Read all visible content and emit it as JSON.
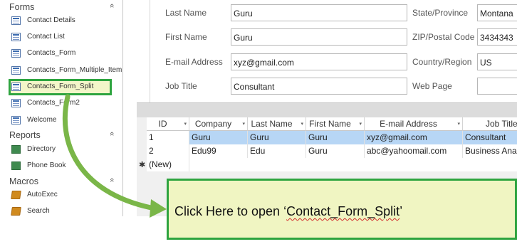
{
  "nav": {
    "groups": [
      {
        "title": "Forms",
        "chevron": "«",
        "icon": "chevron-up-icon"
      },
      {
        "title": "Reports",
        "chevron": "«",
        "icon": "chevron-up-icon"
      },
      {
        "title": "Macros",
        "chevron": "«",
        "icon": "chevron-up-icon"
      }
    ],
    "forms": [
      {
        "label": "Contact Details",
        "icon": "form-icon"
      },
      {
        "label": "Contact List",
        "icon": "form-icon"
      },
      {
        "label": "Contacts_Form",
        "icon": "form-icon"
      },
      {
        "label": "Contacts_Form_Multiple_Item",
        "icon": "form-icon"
      },
      {
        "label": "Contacts_Form_Split",
        "icon": "form-icon",
        "highlighted": true
      },
      {
        "label": "Contacts_Form2",
        "icon": "form-icon"
      },
      {
        "label": "Welcome",
        "icon": "form-icon"
      }
    ],
    "reports": [
      {
        "label": "Directory",
        "icon": "report-icon"
      },
      {
        "label": "Phone Book",
        "icon": "report-icon"
      }
    ],
    "macros": [
      {
        "label": "AutoExec",
        "icon": "macro-icon"
      },
      {
        "label": "Search",
        "icon": "macro-icon"
      }
    ]
  },
  "form": {
    "left": [
      {
        "label": "Last Name",
        "value": "Guru"
      },
      {
        "label": "First Name",
        "value": "Guru"
      },
      {
        "label": "E-mail Address",
        "value": "xyz@gmail.com"
      },
      {
        "label": "Job Title",
        "value": "Consultant"
      }
    ],
    "right": [
      {
        "label": "State/Province",
        "value": "Montana"
      },
      {
        "label": "ZIP/Postal Code",
        "value": "3434343"
      },
      {
        "label": "Country/Region",
        "value": "US"
      },
      {
        "label": "Web Page",
        "value": ""
      }
    ]
  },
  "grid": {
    "columns": [
      "ID",
      "Company",
      "Last Name",
      "First Name",
      "E-mail Address",
      "Job Title"
    ],
    "sort_arrow": "▾",
    "rows": [
      {
        "id": "1",
        "company": "Guru",
        "last": "Guru",
        "first": "Guru",
        "email": "xyz@gmail.com",
        "job": "Consultant",
        "selected": true
      },
      {
        "id": "2",
        "company": "Edu99",
        "last": "Edu",
        "first": "Guru",
        "email": "abc@yahoomail.com",
        "job": "Business Analyst"
      }
    ],
    "new_row": {
      "marker": "✱",
      "label": "(New)"
    }
  },
  "callout": {
    "prefix": "Click Here to open ‘",
    "underlined": "Contact_Form_Split",
    "suffix": "’"
  },
  "colors": {
    "highlight_border": "#2ea43f",
    "highlight_fill": "#f0f5c2",
    "selected_row": "#b7d6f5"
  }
}
